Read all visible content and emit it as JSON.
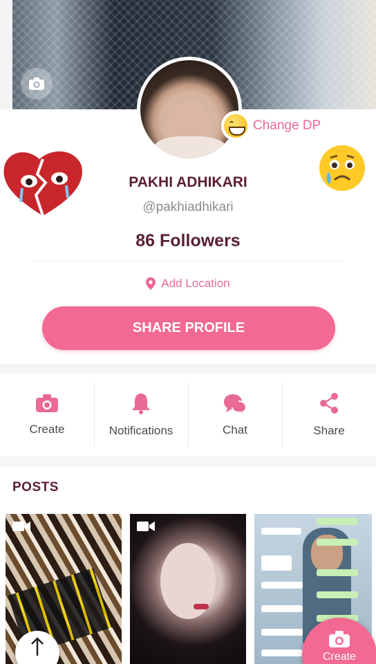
{
  "profile": {
    "change_dp_label": "Change DP",
    "name": "PAKHI ADHIKARI",
    "handle": "@pakhiadhikari",
    "followers": "86 Followers",
    "add_location_label": "Add Location",
    "share_profile_label": "SHARE PROFILE"
  },
  "actions": [
    {
      "label": "Create",
      "icon": "camera-icon"
    },
    {
      "label": "Notifications",
      "icon": "bell-icon"
    },
    {
      "label": "Chat",
      "icon": "chat-bubbles-icon"
    },
    {
      "label": "Share",
      "icon": "share-icon"
    }
  ],
  "posts": {
    "title": "POSTS"
  },
  "fab": {
    "label": "Create",
    "icon": "camera-icon"
  },
  "colors": {
    "accent": "#f26992",
    "accent_text": "#e96a92",
    "name_text": "#5b1f33"
  }
}
